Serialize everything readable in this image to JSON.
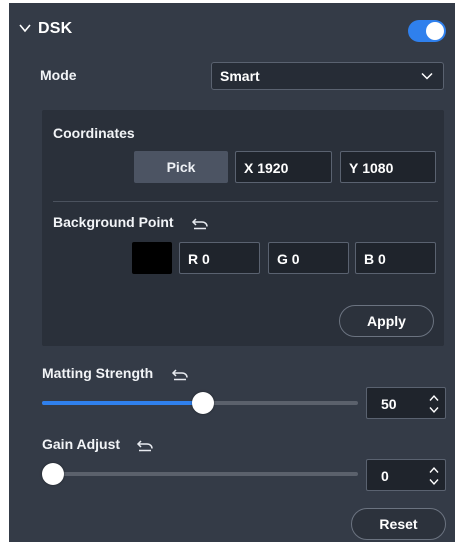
{
  "header": {
    "title": "DSK",
    "enabled": true
  },
  "mode": {
    "label": "Mode",
    "value": "Smart"
  },
  "coordinates": {
    "label": "Coordinates",
    "pick_label": "Pick",
    "x_label": "X",
    "x_value": "1920",
    "y_label": "Y",
    "y_value": "1080"
  },
  "background_point": {
    "label": "Background Point",
    "swatch_color": "#000000",
    "r_label": "R",
    "r_value": "0",
    "g_label": "G",
    "g_value": "0",
    "b_label": "B",
    "b_value": "0",
    "apply_label": "Apply"
  },
  "matting_strength": {
    "label": "Matting Strength",
    "value": "50",
    "fraction": 0.51
  },
  "gain_adjust": {
    "label": "Gain Adjust",
    "value": "0",
    "fraction": 0.0
  },
  "reset_label": "Reset",
  "colors": {
    "accent": "#2f80ed",
    "panel": "#343b47",
    "subpanel": "#2a303a"
  }
}
